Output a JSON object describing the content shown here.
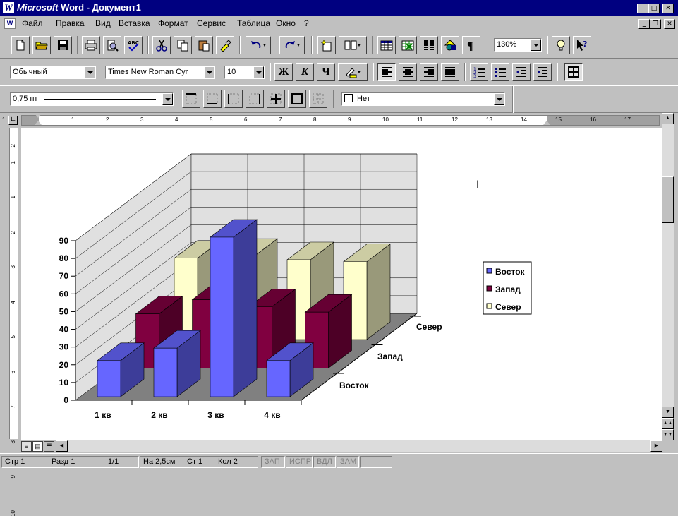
{
  "window": {
    "app_icon": "word-app-icon",
    "title_brand": "Microsoft",
    "title_rest": " Word - Документ1",
    "buttons": [
      "minimize-icon",
      "maximize-icon",
      "close-icon"
    ]
  },
  "menu": {
    "items": [
      "Файл",
      "Правка",
      "Вид",
      "Вставка",
      "Формат",
      "Сервис",
      "Таблица",
      "Окно",
      "?"
    ]
  },
  "standard_toolbar": {
    "zoom": "130%"
  },
  "formatting_toolbar": {
    "style": "Обычный",
    "font": "Times New Roman Cyr",
    "size": "10",
    "bold": "Ж",
    "italic": "К",
    "underline": "Ч"
  },
  "borders_toolbar": {
    "line_weight": "0,75 пт",
    "shading": "Нет"
  },
  "ruler": {
    "h_labels": [
      "1",
      "1",
      "2",
      "3",
      "4",
      "5",
      "6",
      "7",
      "8",
      "9",
      "10",
      "11",
      "12",
      "13",
      "14",
      "15",
      "16",
      "17"
    ],
    "v_labels": [
      "2",
      "1",
      "1",
      "2",
      "3",
      "4",
      "5",
      "6",
      "7",
      "8",
      "9",
      "10"
    ]
  },
  "chart_data": {
    "type": "bar",
    "subtype": "3d-column",
    "categories": [
      "1 кв",
      "2 кв",
      "3 кв",
      "4 кв"
    ],
    "series": [
      {
        "name": "Восток",
        "values": [
          20.4,
          27.4,
          90,
          20.4
        ],
        "color": "#6666ff"
      },
      {
        "name": "Запад",
        "values": [
          30.6,
          38.6,
          34.6,
          31.6
        ],
        "color": "#800040"
      },
      {
        "name": "Север",
        "values": [
          45.9,
          46.9,
          45,
          43.9
        ],
        "color": "#ffffcc"
      }
    ],
    "depth_labels": [
      "Восток",
      "Запад",
      "Север"
    ],
    "ylim": [
      0,
      90
    ],
    "y_ticks": [
      "0",
      "10",
      "20",
      "30",
      "40",
      "50",
      "60",
      "70",
      "80",
      "90"
    ],
    "legend_position": "right",
    "grid": true
  },
  "status": {
    "page": "Стр 1",
    "section": "Разд 1",
    "pages": "1/1",
    "position": "На 2,5см",
    "line": "Ст 1",
    "column": "Кол 2",
    "rec": "ЗАП",
    "trk": "ИСПР",
    "ext": "ВДЛ",
    "ovr": "ЗАМ"
  }
}
